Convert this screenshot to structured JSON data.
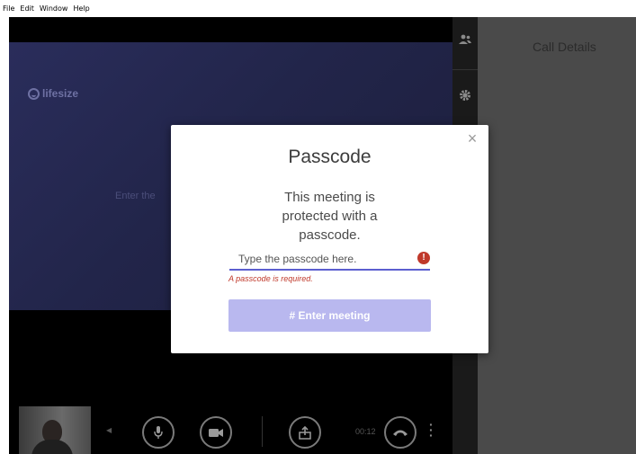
{
  "menubar": {
    "items": [
      "File",
      "Edit",
      "Window",
      "Help"
    ]
  },
  "stage": {
    "brand": "lifesize",
    "hint_text": "Enter the"
  },
  "panel": {
    "title": "Call Details"
  },
  "controls": {
    "timer": "00:12"
  },
  "modal": {
    "title": "Passcode",
    "description": "This meeting is protected with a passcode.",
    "input_placeholder": "Type the passcode here.",
    "input_value": "",
    "error_icon": "!",
    "error_message": "A passcode is required.",
    "enter_button": "# Enter meeting",
    "close_glyph": "×"
  },
  "colors": {
    "accent": "#5c5fd0",
    "button_disabled": "#b9b8ef",
    "error": "#c0392b",
    "panel_bg": "#4a4a4a",
    "stage_bg": "#2a2d5b"
  },
  "icons": {
    "participants": "participants-icon",
    "settings": "gear-icon",
    "microphone": "microphone-icon",
    "camera": "video-camera-icon",
    "share": "share-screen-icon",
    "hangup": "hangup-icon",
    "more": "more-vertical-icon",
    "close": "close-icon",
    "error": "error-icon"
  }
}
